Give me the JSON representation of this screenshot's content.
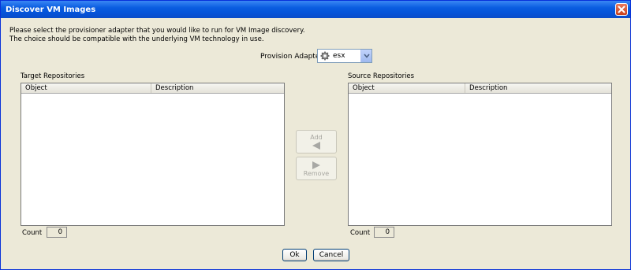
{
  "window": {
    "title": "Discover VM Images"
  },
  "instructions": {
    "line1": "Please select the provisioner adapter that you would like to run for VM Image discovery.",
    "line2": "The choice should be compatible with the underlying VM technology in use."
  },
  "adapter": {
    "label": "Provision Adapter",
    "selected": "esx"
  },
  "target": {
    "title": "Target Repositories",
    "columns": [
      "Object",
      "Description"
    ],
    "count_label": "Count",
    "count": "0"
  },
  "source": {
    "title": "Source Repositories",
    "columns": [
      "Object",
      "Description"
    ],
    "count_label": "Count",
    "count": "0"
  },
  "actions": {
    "add": "Add",
    "remove": "Remove"
  },
  "buttons": {
    "ok": "Ok",
    "cancel": "Cancel"
  },
  "colors": {
    "titlebar": "#0554d9",
    "background": "#ece9d8"
  }
}
